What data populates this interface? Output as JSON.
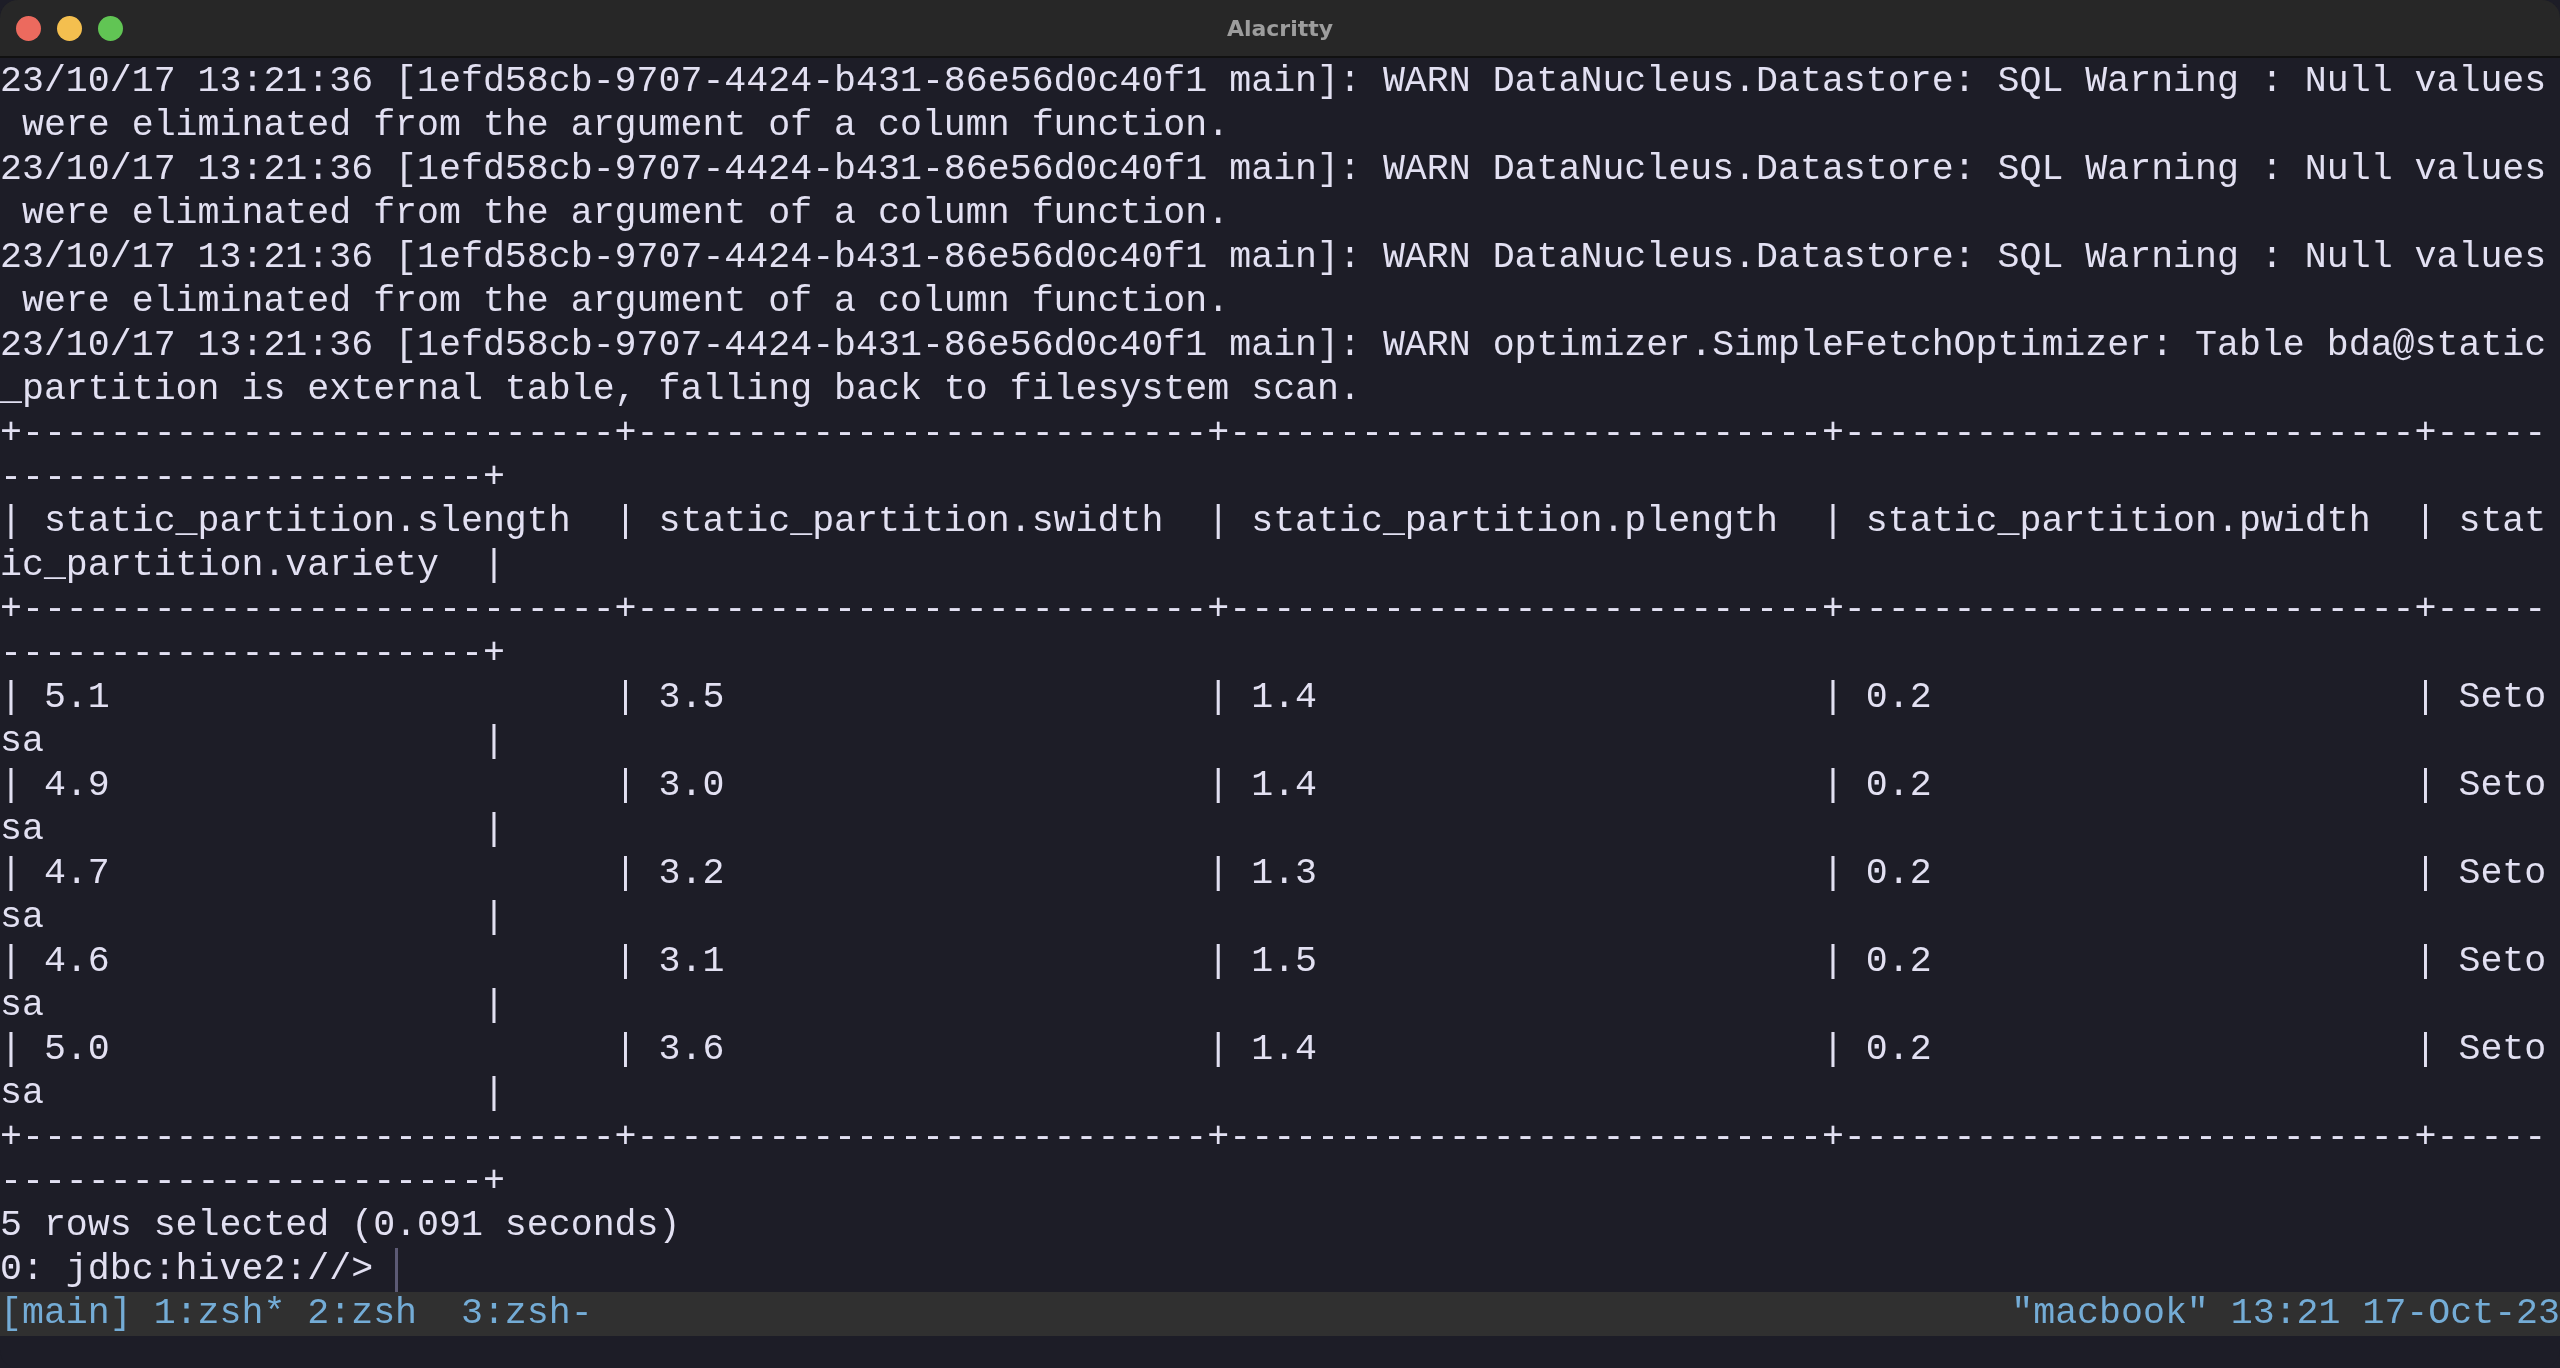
{
  "window": {
    "title": "Alacritty"
  },
  "terminal": {
    "lines": [
      "23/10/17 13:21:36 [1efd58cb-9707-4424-b431-86e56d0c40f1 main]: WARN DataNucleus.Datastore: SQL Warning : Null values",
      " were eliminated from the argument of a column function.",
      "23/10/17 13:21:36 [1efd58cb-9707-4424-b431-86e56d0c40f1 main]: WARN DataNucleus.Datastore: SQL Warning : Null values",
      " were eliminated from the argument of a column function.",
      "23/10/17 13:21:36 [1efd58cb-9707-4424-b431-86e56d0c40f1 main]: WARN DataNucleus.Datastore: SQL Warning : Null values",
      " were eliminated from the argument of a column function.",
      "23/10/17 13:21:36 [1efd58cb-9707-4424-b431-86e56d0c40f1 main]: WARN optimizer.SimpleFetchOptimizer: Table bda@static",
      "_partition is external table, falling back to filesystem scan.",
      "+---------------------------+--------------------------+---------------------------+--------------------------+-----",
      "----------------------+",
      "| static_partition.slength  | static_partition.swidth  | static_partition.plength  | static_partition.pwidth  | stat",
      "ic_partition.variety  |",
      "+---------------------------+--------------------------+---------------------------+--------------------------+-----",
      "----------------------+",
      "| 5.1                       | 3.5                      | 1.4                       | 0.2                      | Seto",
      "sa                    |",
      "| 4.9                       | 3.0                      | 1.4                       | 0.2                      | Seto",
      "sa                    |",
      "| 4.7                       | 3.2                      | 1.3                       | 0.2                      | Seto",
      "sa                    |",
      "| 4.6                       | 3.1                      | 1.5                       | 0.2                      | Seto",
      "sa                    |",
      "| 5.0                       | 3.6                      | 1.4                       | 0.2                      | Seto",
      "sa                    |",
      "+---------------------------+--------------------------+---------------------------+--------------------------+-----",
      "----------------------+",
      "5 rows selected (0.091 seconds)"
    ],
    "prompt": "0: jdbc:hive2://>"
  },
  "status_bar": {
    "left": "[main] 1:zsh* 2:zsh  3:zsh-",
    "right": "\"macbook\" 13:21 17-Oct-23"
  }
}
